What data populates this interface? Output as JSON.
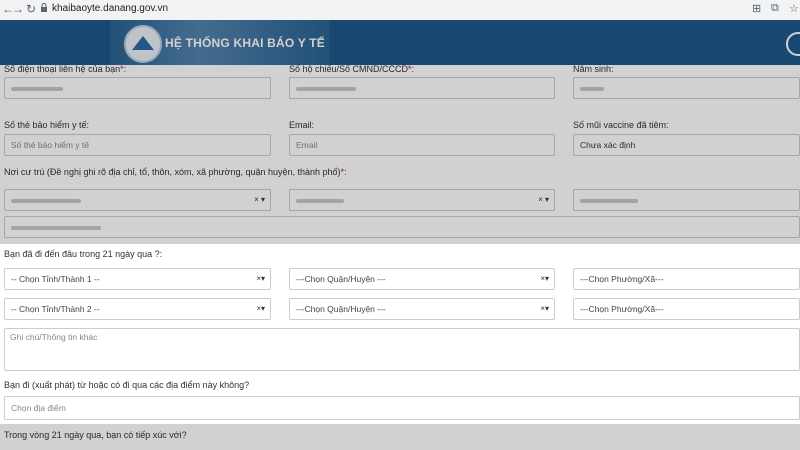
{
  "browser": {
    "url": "khaibaoyte.danang.gov.vn"
  },
  "site": {
    "title": "HỆ THỐNG KHAI BÁO Y TẾ"
  },
  "form": {
    "phone_label": "Số điện thoại liên hệ của bạn",
    "passport_label": "Số hộ chiếu/Số CMND/CCCD",
    "birth_year_label": "Năm sinh:",
    "insurance_label": "Số thẻ bảo hiểm y tế:",
    "insurance_placeholder": "Số thẻ bảo hiểm y tế",
    "email_label": "Email:",
    "email_placeholder": "Email",
    "vaccine_label": "Số mũi vaccine đã tiêm:",
    "vaccine_value": "Chưa xác định",
    "residence_label": "Nơi cư trú (Đề nghị ghi rõ địa chỉ, tổ, thôn, xóm, xã phường, quận huyện, thành phố)",
    "travel_question": "Bạn đã đi đến đâu trong 21 ngày qua ?:",
    "province1_placeholder": "-- Chọn Tỉnh/Thành 1 --",
    "province2_placeholder": "-- Chọn Tỉnh/Thành 2 --",
    "district_placeholder": "---Chọn Quận/Huyện ---",
    "ward_placeholder": "---Chọn Phường/Xã---",
    "notes_placeholder": "Ghi chú/Thông tin khác",
    "departure_question": "Bạn đi (xuất phát) từ hoặc có đi qua các địa điểm này không?",
    "location_placeholder": "Chọn địa điểm",
    "contact_question": "Trong vòng 21 ngày qua, bạn có tiếp xúc với?",
    "required_mark": "*",
    "clear_mark": "×",
    "dropdown_mark": "▾"
  },
  "icons": {
    "back": "back-arrow-icon",
    "forward": "forward-arrow-icon",
    "reload": "reload-icon",
    "lock": "lock-icon",
    "user": "user-icon"
  },
  "colors": {
    "header": "#1f5a8c",
    "required": "#dd0000"
  }
}
